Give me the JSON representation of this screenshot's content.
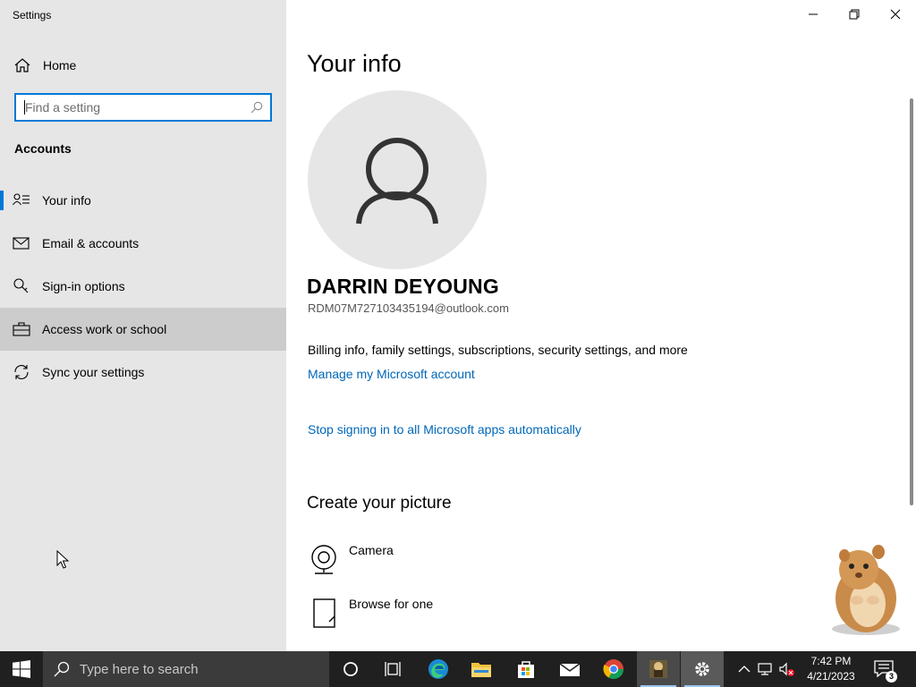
{
  "window": {
    "title": "Settings",
    "controls": {
      "minimize": "minimize",
      "restore": "restore",
      "close": "close"
    }
  },
  "sidebar": {
    "home_label": "Home",
    "search_placeholder": "Find a setting",
    "section_title": "Accounts",
    "items": [
      {
        "label": "Your info",
        "icon": "person-list-icon",
        "selected": true
      },
      {
        "label": "Email & accounts",
        "icon": "mail-icon"
      },
      {
        "label": "Sign-in options",
        "icon": "key-icon"
      },
      {
        "label": "Access work or school",
        "icon": "briefcase-icon",
        "hovered": true
      },
      {
        "label": "Sync your settings",
        "icon": "sync-icon"
      }
    ]
  },
  "main": {
    "title": "Your info",
    "user_name": "DARRIN DEYOUNG",
    "user_email": "RDM07M727103435194@outlook.com",
    "billing_text": "Billing info, family settings, subscriptions, security settings, and more",
    "manage_link": "Manage my Microsoft account",
    "stop_link": "Stop signing in to all Microsoft apps automatically",
    "create_picture_title": "Create your picture",
    "picture_options": [
      {
        "label": "Camera",
        "icon": "camera-icon"
      },
      {
        "label": "Browse for one",
        "icon": "browse-icon"
      }
    ]
  },
  "taskbar": {
    "search_placeholder": "Type here to search",
    "apps": [
      "cortana-icon",
      "task-view-icon",
      "edge-icon",
      "file-explorer-icon",
      "store-icon",
      "mail-app-icon",
      "chrome-icon",
      "game-app-icon",
      "settings-app-icon"
    ],
    "time": "7:42 PM",
    "date": "4/21/2023",
    "notification_count": "3"
  },
  "colors": {
    "accent": "#0078d7",
    "link": "#0067b8",
    "sidebar_bg": "#e6e6e6",
    "taskbar_bg": "#202020"
  }
}
